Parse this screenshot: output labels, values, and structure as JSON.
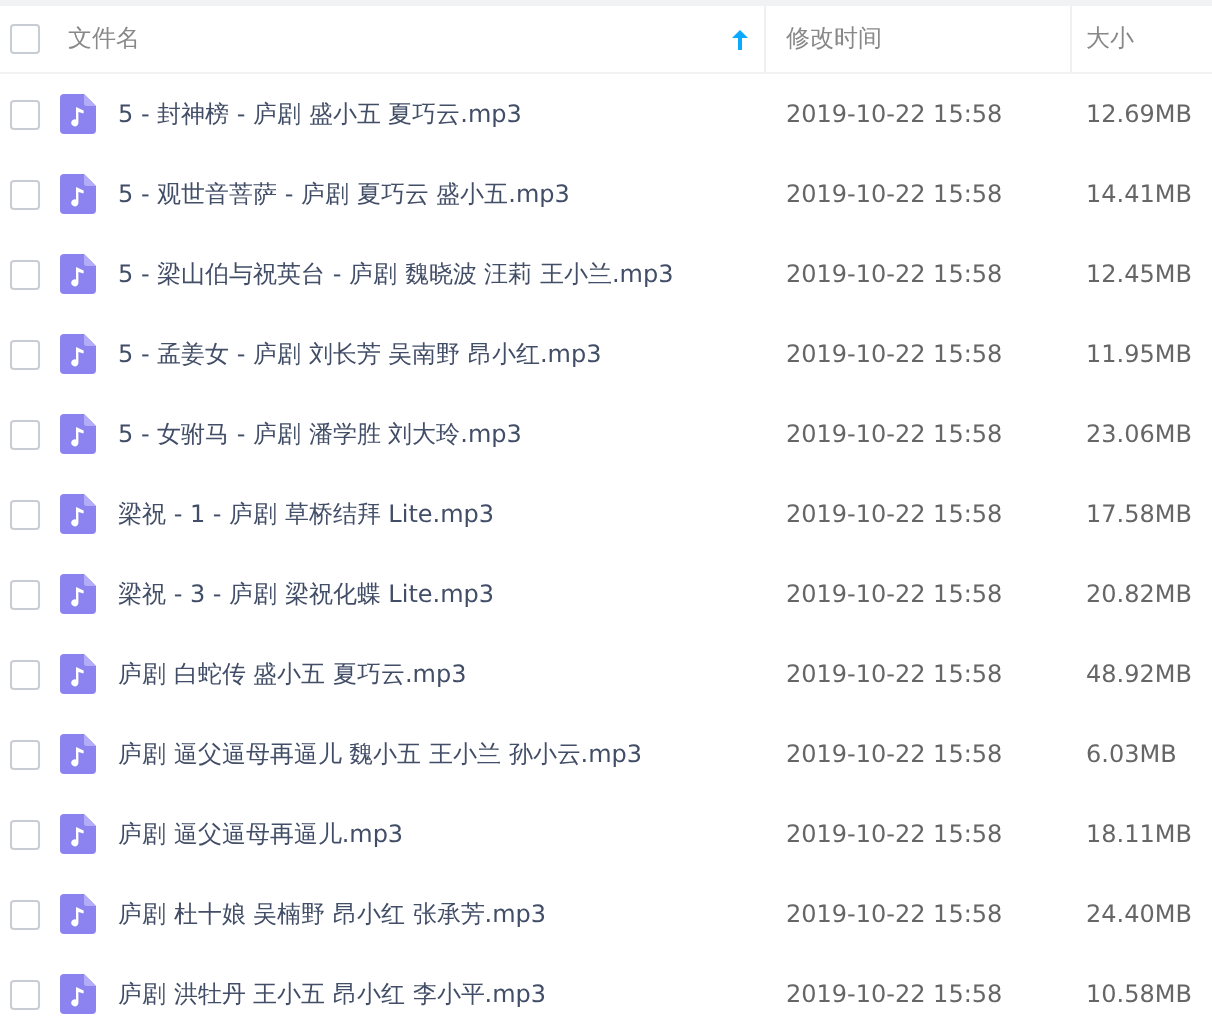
{
  "header": {
    "checked": false,
    "columns": [
      {
        "label": "文件名",
        "sorted": true
      },
      {
        "label": "修改时间",
        "sorted": false
      },
      {
        "label": "大小",
        "sorted": false
      }
    ]
  },
  "rows": [
    {
      "name": "5 - 封神榜 - 庐剧 盛小五 夏巧云.mp3",
      "time": "2019-10-22 15:58",
      "size": "12.69MB",
      "checked": false
    },
    {
      "name": "5 - 观世音菩萨 - 庐剧 夏巧云 盛小五.mp3",
      "time": "2019-10-22 15:58",
      "size": "14.41MB",
      "checked": false
    },
    {
      "name": "5 - 梁山伯与祝英台 - 庐剧 魏晓波 汪莉 王小兰.mp3",
      "time": "2019-10-22 15:58",
      "size": "12.45MB",
      "checked": false
    },
    {
      "name": "5 - 孟姜女 - 庐剧 刘长芳 吴南野 昂小红.mp3",
      "time": "2019-10-22 15:58",
      "size": "11.95MB",
      "checked": false
    },
    {
      "name": "5 - 女驸马 - 庐剧 潘学胜 刘大玲.mp3",
      "time": "2019-10-22 15:58",
      "size": "23.06MB",
      "checked": false
    },
    {
      "name": "梁祝 - 1 - 庐剧 草桥结拜 Lite.mp3",
      "time": "2019-10-22 15:58",
      "size": "17.58MB",
      "checked": false
    },
    {
      "name": "梁祝 - 3 - 庐剧 梁祝化蝶 Lite.mp3",
      "time": "2019-10-22 15:58",
      "size": "20.82MB",
      "checked": false
    },
    {
      "name": "庐剧 白蛇传 盛小五 夏巧云.mp3",
      "time": "2019-10-22 15:58",
      "size": "48.92MB",
      "checked": false
    },
    {
      "name": "庐剧 逼父逼母再逼儿 魏小五 王小兰 孙小云.mp3",
      "time": "2019-10-22 15:58",
      "size": "6.03MB",
      "checked": false
    },
    {
      "name": "庐剧 逼父逼母再逼儿.mp3",
      "time": "2019-10-22 15:58",
      "size": "18.11MB",
      "checked": false
    },
    {
      "name": "庐剧 杜十娘 吴楠野 昂小红 张承芳.mp3",
      "time": "2019-10-22 15:58",
      "size": "24.40MB",
      "checked": false
    },
    {
      "name": "庐剧 洪牡丹 王小五 昂小红 李小平.mp3",
      "time": "2019-10-22 15:58",
      "size": "10.58MB",
      "checked": false
    }
  ]
}
